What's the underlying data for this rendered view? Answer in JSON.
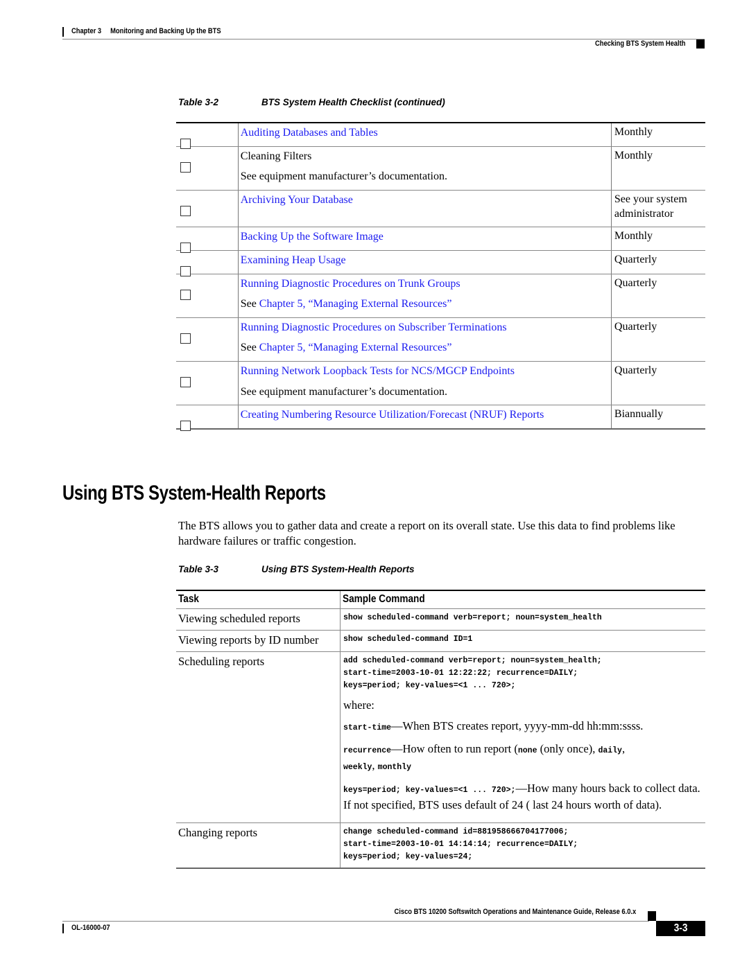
{
  "header": {
    "chapter": "Chapter 3",
    "chapter_title": "Monitoring and Backing Up the BTS",
    "section": "Checking BTS System Health"
  },
  "checklist_table": {
    "number": "Table 3-2",
    "title": "BTS System Health Checklist (continued)",
    "rows": [
      {
        "task": "Auditing Databases and Tables",
        "task_is_link": true,
        "note_prefix": "",
        "note": "",
        "note_is_link": false,
        "frequency": "Monthly",
        "checked": false
      },
      {
        "task": "Cleaning Filters",
        "task_is_link": false,
        "note_prefix": "",
        "note": "See equipment manufacturer’s documentation.",
        "note_is_link": false,
        "frequency": "Monthly",
        "checked": false
      },
      {
        "task": "Archiving Your Database",
        "task_is_link": true,
        "note_prefix": "",
        "note": "",
        "note_is_link": false,
        "frequency": "See your system administrator",
        "checked": false
      },
      {
        "task": "Backing Up the Software Image",
        "task_is_link": true,
        "note_prefix": "",
        "note": "",
        "note_is_link": false,
        "frequency": "Monthly",
        "checked": false
      },
      {
        "task": "Examining Heap Usage",
        "task_is_link": true,
        "note_prefix": "",
        "note": "",
        "note_is_link": false,
        "frequency": "Quarterly",
        "checked": false
      },
      {
        "task": "Running Diagnostic Procedures on Trunk Groups",
        "task_is_link": true,
        "note_prefix": "See ",
        "note": "Chapter 5, “Managing External Resources”",
        "note_is_link": true,
        "frequency": "Quarterly",
        "checked": false
      },
      {
        "task": "Running Diagnostic Procedures on Subscriber Terminations",
        "task_is_link": true,
        "note_prefix": "See ",
        "note": "Chapter 5, “Managing External Resources”",
        "note_is_link": true,
        "frequency": "Quarterly",
        "checked": false
      },
      {
        "task": "Running Network Loopback Tests for NCS/MGCP Endpoints",
        "task_is_link": true,
        "note_prefix": "",
        "note": "See equipment manufacturer’s documentation.",
        "note_is_link": false,
        "frequency": "Quarterly",
        "checked": false
      },
      {
        "task": "Creating Numbering Resource Utilization/Forecast (NRUF) Reports",
        "task_is_link": true,
        "note_prefix": "",
        "note": "",
        "note_is_link": false,
        "frequency": "Biannually",
        "checked": false
      }
    ]
  },
  "section": {
    "title": "Using BTS System-Health Reports",
    "intro": "The BTS allows you to gather data and create a report on its overall state. Use this data to find problems like hardware failures or traffic congestion."
  },
  "reports_table": {
    "number": "Table 3-3",
    "title": "Using BTS System-Health Reports",
    "headers": [
      "Task",
      "Sample Command"
    ],
    "rows": [
      {
        "task": "Viewing scheduled reports",
        "command": "show scheduled-command verb=report; noun=system_health"
      },
      {
        "task": "Viewing reports by ID number",
        "command": "show scheduled-command ID=1"
      },
      {
        "task": "Scheduling reports",
        "command": "add scheduled-command verb=report; noun=system_health;\nstart-time=2003-10-01 12:22:22; recurrence=DAILY;\nkeys=period; key-values=<1 ... 720>;",
        "where_label": "where:",
        "params": [
          {
            "name": "start-time",
            "desc": "—When BTS creates report, yyyy-mm-dd hh:mm:ssss."
          },
          {
            "name": "recurrence",
            "desc": "—How often to run report (",
            "opt1": "none",
            "mid": " (only once), ",
            "opt2": "daily",
            "sep": ",",
            "opt3": "weekly",
            "sep2": ", ",
            "opt4": "monthly"
          },
          {
            "name": "keys=period; key-values=<1 ... 720>;",
            "desc": "—How many hours back to collect data. If not specified, BTS uses default of 24 ( last 24 hours worth of data)."
          }
        ]
      },
      {
        "task": "Changing reports",
        "command": "change scheduled-command id=881958666704177006;\nstart-time=2003-10-01 14:14:14; recurrence=DAILY;\nkeys=period; key-values=24;"
      }
    ]
  },
  "footer": {
    "guide_title": "Cisco BTS 10200 Softswitch Operations and Maintenance Guide, Release 6.0.x",
    "doc_number": "OL-16000-07",
    "page_number": "3-3"
  },
  "colors": {
    "link": "#1b1bf0",
    "text": "#000000",
    "rule": "#888888"
  }
}
